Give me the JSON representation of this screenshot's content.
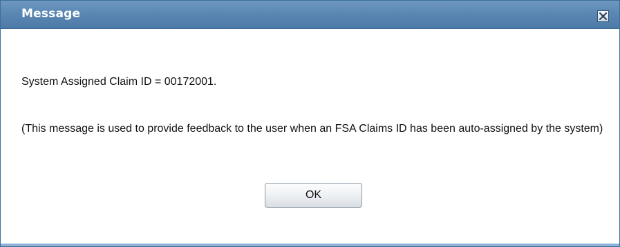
{
  "dialog": {
    "title": "Message",
    "close_icon": "close-icon",
    "message_line": "System Assigned Claim ID = 00172001.",
    "message_note": "(This message is used to provide feedback to the user when an FSA Claims ID has been auto-assigned by the system)",
    "ok_label": "OK"
  },
  "colors": {
    "titlebar": "#5b87b3",
    "title_text": "#ffffff",
    "bottom_accent": "#8fb3d6"
  }
}
